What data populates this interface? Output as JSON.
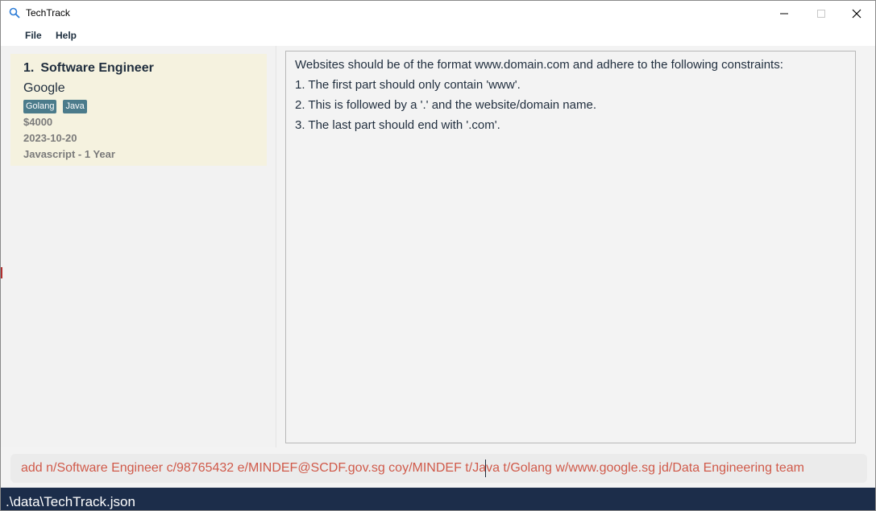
{
  "window": {
    "title": "TechTrack",
    "controls": {
      "minimize_icon": "minimize-icon",
      "maximize_icon": "maximize-icon",
      "close_icon": "close-icon"
    }
  },
  "menu": {
    "items": [
      "File",
      "Help"
    ]
  },
  "job_list": {
    "items": [
      {
        "index": "1.",
        "role": "Software Engineer",
        "company": "Google",
        "tags": [
          "Golang",
          "Java"
        ],
        "salary": "$4000",
        "deadline": "2023-10-20",
        "experience": "Javascript - 1 Year"
      }
    ]
  },
  "result_display": {
    "lines": [
      "Websites should be of the format www.domain.com and adhere to the following constraints:",
      "1. The first part should only contain 'www'.",
      "2. This is followed by a '.' and the website/domain name.",
      "3. The last part should end with '.com'."
    ]
  },
  "command_box": {
    "value": "add n/Software Engineer c/98765432 e/MINDEF@SCDF.gov.sg coy/MINDEF t/Java t/Golang w/www.google.sg jd/Data Engineering team"
  },
  "status_bar": {
    "path": ".\\data\\TechTrack.json"
  },
  "colors": {
    "card_background": "#f5f2df",
    "tag_background": "#4b7b8b",
    "command_text": "#d05a4a",
    "status_bar": "#1c2d4a",
    "text_primary": "#1f2d3d"
  }
}
